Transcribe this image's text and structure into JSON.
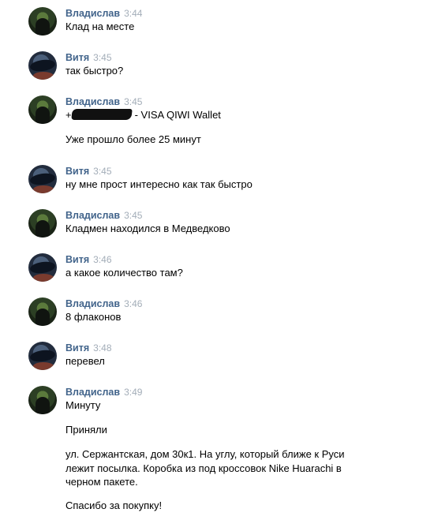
{
  "messages": [
    {
      "author": "Владислав",
      "time": "3:44",
      "lines": [
        "Клад на месте"
      ]
    },
    {
      "author": "Витя",
      "time": "3:45",
      "lines": [
        "так быстро?"
      ]
    },
    {
      "author": "Владислав",
      "time": "3:45",
      "lines": [
        "+",
        "- VISA QIWI Wallet",
        "Уже прошло более 25 минут"
      ]
    },
    {
      "author": "Витя",
      "time": "3:45",
      "lines": [
        "ну мне прост интересно как так быстро"
      ]
    },
    {
      "author": "Владислав",
      "time": "3:45",
      "lines": [
        "Кладмен находился в Медведково"
      ]
    },
    {
      "author": "Витя",
      "time": "3:46",
      "lines": [
        "а какое количество там?"
      ]
    },
    {
      "author": "Владислав",
      "time": "3:46",
      "lines": [
        "8 флаконов"
      ]
    },
    {
      "author": "Витя",
      "time": "3:48",
      "lines": [
        "перевел"
      ]
    },
    {
      "author": "Владислав",
      "time": "3:49",
      "lines": [
        "Минуту",
        "Приняли",
        "ул. Сержантская, дом 30к1. На углу, который ближе к Руси",
        "лежит посылка. Коробка из под кроссовок Nike Huarachi в",
        "черном пакете.",
        "Спасибо за покупку!"
      ]
    }
  ]
}
